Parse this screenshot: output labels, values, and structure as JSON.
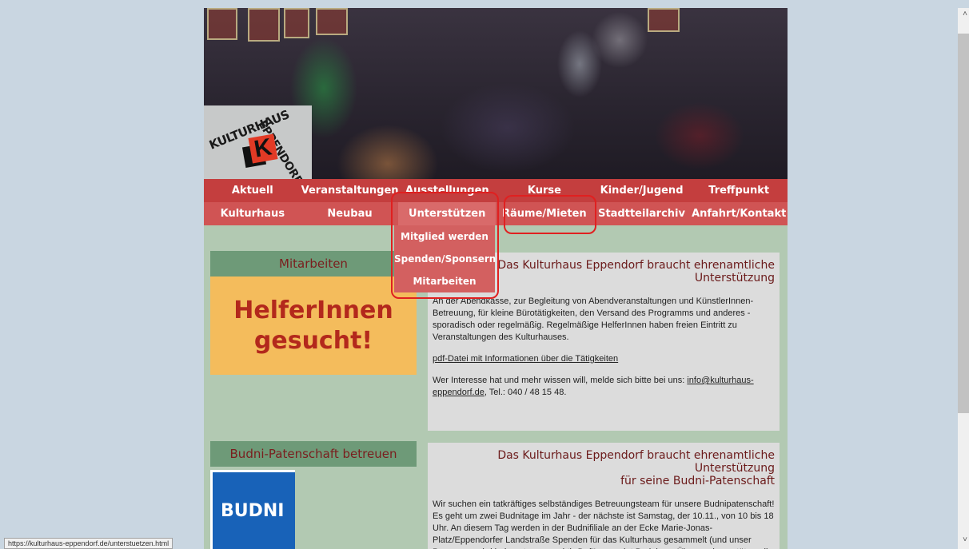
{
  "header": {
    "logo_text": "KULTURHAUS EPPENDORF",
    "logo_letter": "K"
  },
  "nav": {
    "row1": [
      "Aktuell",
      "Veranstaltungen",
      "Ausstellungen",
      "Kurse",
      "Kinder/Jugend",
      "Treffpunkt"
    ],
    "row2": [
      "Kulturhaus",
      "Neubau",
      "Unterstützen",
      "Räume/Mieten",
      "Stadtteilarchiv",
      "Anfahrt/Kontakt"
    ]
  },
  "dropdown": [
    "Mitglied werden",
    "Spenden/Sponsern",
    "Mitarbeiten"
  ],
  "sidebar": {
    "section1": {
      "title": "Mitarbeiten",
      "banner_line1": "HelferInnen",
      "banner_line2": "gesucht!"
    },
    "section2": {
      "title": "Budni-Patenschaft betreuen",
      "logo_label": "BUDNI"
    }
  },
  "content": {
    "box1": {
      "title": "Das Kulturhaus Eppendorf braucht ehrenamtliche Unterstützung",
      "para1": "An der Abendkasse, zur Begleitung von Abendveranstaltungen und KünstlerInnen-Betreuung, für kleine Bürotätigkeiten, den Versand des Programms und anderes - sporadisch oder regelmäßig. Regelmäßige HelferInnen haben freien Eintritt zu Veranstaltungen des Kulturhauses.",
      "pdf_link": "pdf-Datei mit Informationen über die Tätigkeiten",
      "contact_prefix": "Wer Interesse hat und mehr wissen will, melde sich bitte bei uns: ",
      "contact_email": "info@kulturhaus-eppendorf.de",
      "contact_suffix": ", Tel.: 040 / 48 15 48."
    },
    "box2": {
      "title_line1": "Das Kulturhaus Eppendorf braucht ehrenamtliche Unterstützung",
      "title_line2": "für seine Budni-Patenschaft",
      "para1": "Wir suchen ein tatkräftiges selbständiges Betreuungsteam für unsere Budnipatenschaft! Es geht um zwei Budnitage im Jahr - der nächste ist Samstag, der 10.11., von 10 bis 18 Uhr. An diesem Tag werden in der Budnifiliale an der Ecke Marie-Jonas-Platz/Eppendorfer Landstraße Spenden für das Kulturhaus gesammelt (und unser Programm wird bekannter gemacht). Dafür spendet Budni uns Überraschungstüten, die wir verkaufen dürfen sowie Luftballons, Lollies, Preise und"
    }
  },
  "status_url": "https://kulturhaus-eppendorf.de/unterstuetzen.html",
  "colors": {
    "nav_row1": "#c43e3e",
    "nav_row2": "#d05454",
    "highlight": "#e02020",
    "title_text": "#6b1a1a"
  }
}
